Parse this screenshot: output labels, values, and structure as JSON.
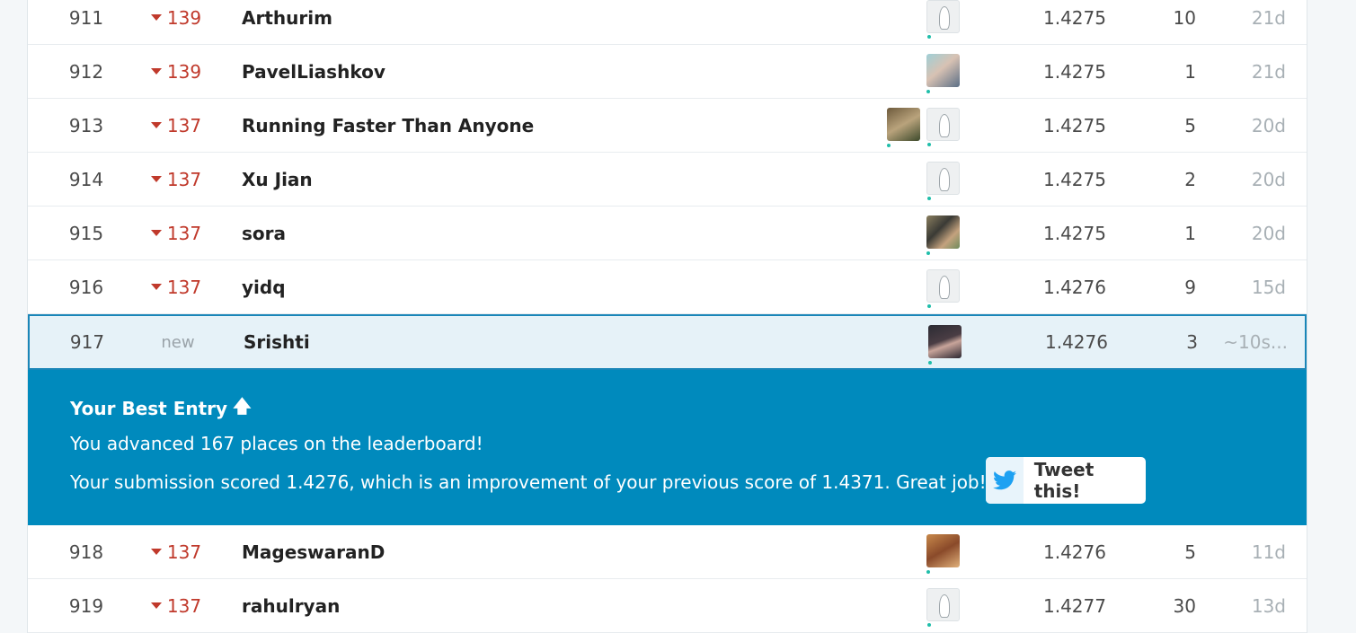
{
  "rows_before": [
    {
      "rank": "911",
      "change": "139",
      "team": "Arthurim",
      "score": "1.4275",
      "entries": "10",
      "last": "21d",
      "avatars": [
        "goose"
      ]
    },
    {
      "rank": "912",
      "change": "139",
      "team": "PavelLiashkov",
      "score": "1.4275",
      "entries": "1",
      "last": "21d",
      "avatars": [
        "photo"
      ]
    },
    {
      "rank": "913",
      "change": "137",
      "team": "Running Faster Than Anyone",
      "score": "1.4275",
      "entries": "5",
      "last": "20d",
      "avatars": [
        "photo",
        "goose"
      ]
    },
    {
      "rank": "914",
      "change": "137",
      "team": "Xu Jian",
      "score": "1.4275",
      "entries": "2",
      "last": "20d",
      "avatars": [
        "goose"
      ]
    },
    {
      "rank": "915",
      "change": "137",
      "team": "sora",
      "score": "1.4275",
      "entries": "1",
      "last": "20d",
      "avatars": [
        "photo"
      ]
    },
    {
      "rank": "916",
      "change": "137",
      "team": "yidq",
      "score": "1.4276",
      "entries": "9",
      "last": "15d",
      "avatars": [
        "goose"
      ]
    }
  ],
  "my_row": {
    "rank": "917",
    "change": "new",
    "team": "Srishti",
    "score": "1.4276",
    "entries": "3",
    "last": "~10s..."
  },
  "banner": {
    "title": "Your Best Entry",
    "advanced": "You advanced 167 places on the leaderboard!",
    "scored": "Your submission scored 1.4276, which is an improvement of your previous score of 1.4371. Great job!",
    "tweet_label": "Tweet this!"
  },
  "rows_after": [
    {
      "rank": "918",
      "change": "137",
      "team": "MageswaranD",
      "score": "1.4276",
      "entries": "5",
      "last": "11d",
      "avatars": [
        "photo"
      ]
    },
    {
      "rank": "919",
      "change": "137",
      "team": "rahulryan",
      "score": "1.4277",
      "entries": "30",
      "last": "13d",
      "avatars": [
        "goose"
      ]
    }
  ],
  "colors": {
    "accent": "#008abd",
    "down": "#c0392b",
    "highlight": "#e6f2f8"
  },
  "icons": {
    "change": "down-triangle-icon",
    "rank_up": "arrow-up-icon",
    "tweet": "twitter-bird-icon"
  }
}
